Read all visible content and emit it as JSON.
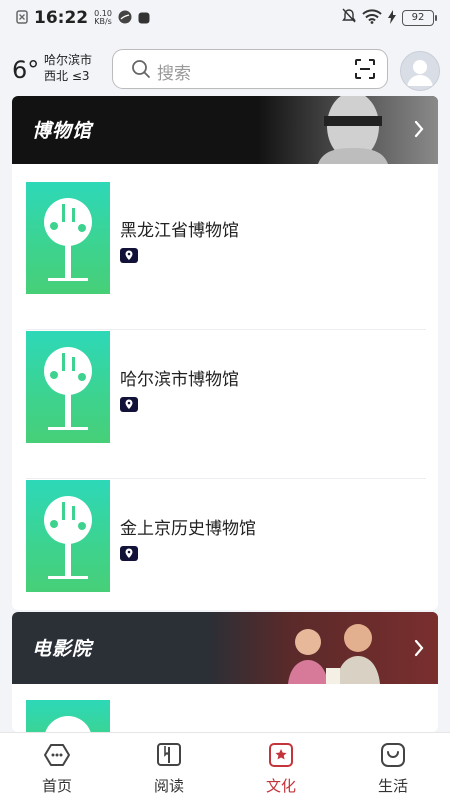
{
  "status": {
    "time": "16:22",
    "speed_value": "0.10",
    "speed_unit": "KB/s",
    "battery": "92"
  },
  "header": {
    "temperature": "6°",
    "city": "哈尔滨市",
    "wind": "西北 ≤3",
    "search_placeholder": "搜索"
  },
  "sections": [
    {
      "title": "博物馆",
      "items": [
        {
          "name": "黑龙江省博物馆"
        },
        {
          "name": "哈尔滨市博物馆"
        },
        {
          "name": "金上京历史博物馆"
        }
      ]
    },
    {
      "title": "电影院"
    }
  ],
  "tabs": [
    {
      "label": "首页",
      "icon": "home-icon"
    },
    {
      "label": "阅读",
      "icon": "book-icon"
    },
    {
      "label": "文化",
      "icon": "culture-icon",
      "active": true
    },
    {
      "label": "生活",
      "icon": "life-icon"
    }
  ],
  "colors": {
    "accent": "#c4343b",
    "thumb_green": "#3dd38e",
    "banner_dark": "#121212"
  }
}
